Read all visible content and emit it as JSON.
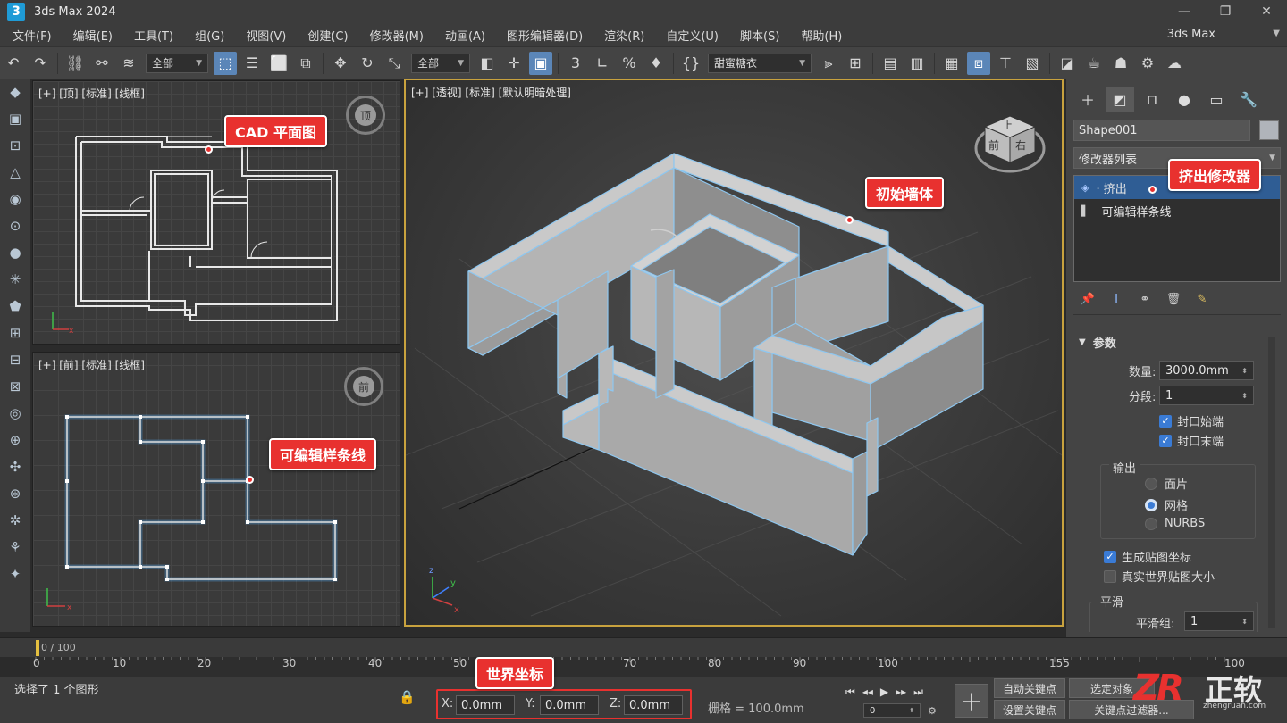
{
  "app": {
    "logo_text": "3",
    "title": "3ds Max 2024",
    "workspace": "3ds Max"
  },
  "window_controls": [
    "—",
    "❐",
    "✕"
  ],
  "menu": [
    "文件(F)",
    "编辑(E)",
    "工具(T)",
    "组(G)",
    "视图(V)",
    "创建(C)",
    "修改器(M)",
    "动画(A)",
    "图形编辑器(D)",
    "渲染(R)",
    "自定义(U)",
    "脚本(S)",
    "帮助(H)"
  ],
  "toolbar": {
    "selection_filter": "全部",
    "ref_coord": "全部",
    "named_selection": "甜蜜糖衣",
    "icons": [
      "undo-icon",
      "redo-icon",
      "link-icon",
      "unlink-icon",
      "bind-icon",
      "select-icon",
      "select-by-name-icon",
      "rect-region-icon",
      "window-crossing-icon",
      "move-icon",
      "rotate-icon",
      "scale-icon",
      "pivot-icon",
      "snap-icon",
      "angle-snap-icon",
      "percent-snap-icon",
      "spinner-snap-icon",
      "edit-named-sel-icon",
      "mirror-icon",
      "align-icon",
      "layer-icon",
      "ribbon-icon",
      "render-setup-icon",
      "render-frame-icon",
      "render-icon"
    ]
  },
  "viewports": {
    "top": {
      "label": "[+] [顶] [标准] [线框]",
      "cube": "顶",
      "callout": "CAD 平面图"
    },
    "front": {
      "label": "[+] [前] [标准] [线框]",
      "cube": "前",
      "callout": "可编辑样条线"
    },
    "persp": {
      "label": "[+] [透视] [标准] [默认明暗处理]",
      "cube_top": "上",
      "cube_front": "前",
      "cube_right": "右",
      "callout": "初始墙体"
    }
  },
  "panel": {
    "object_name": "Shape001",
    "modifier_list": "修改器列表",
    "stack": [
      {
        "label": "· 挤出",
        "selected": true
      },
      {
        "label": "可编辑样条线",
        "selected": false
      }
    ],
    "stack_callout": "挤出修改器",
    "rollout_title": "参数",
    "amount_label": "数量:",
    "amount_value": "3000.0mm",
    "segments_label": "分段:",
    "segments_value": "1",
    "cap_start": "封口始端",
    "cap_end": "封口末端",
    "output_label": "输出",
    "output_options": [
      "面片",
      "网格",
      "NURBS"
    ],
    "output_selected": 1,
    "gen_mapping": "生成贴图坐标",
    "real_world": "真实世界贴图大小",
    "smooth_label": "平滑",
    "smooth_group_label": "平滑组:",
    "smooth_group_value": "1"
  },
  "timeline": {
    "frame_display": "0 / 100",
    "ticks": [
      "0",
      "10",
      "20",
      "30",
      "40",
      "50",
      "60",
      "70",
      "80",
      "90",
      "100",
      "155",
      "100"
    ]
  },
  "status": {
    "selection_text": "选择了 1 个图形",
    "coord_callout": "世界坐标",
    "x_label": "X:",
    "x_value": "0.0mm",
    "y_label": "Y:",
    "y_value": "0.0mm",
    "z_label": "Z:",
    "z_value": "0.0mm",
    "grid_text": "栅格 = 100.0mm",
    "auto_key": "自动关键点",
    "set_key": "设置关键点",
    "selected_label": "选定对象",
    "key_filters": "关键点过滤器...",
    "frame_field": "0"
  },
  "watermark": {
    "logo": "ZR",
    "name": "正软",
    "url": "zhengruan.com"
  },
  "colors": {
    "accent_blue": "#3a7bd5",
    "callout_red": "#e8312f",
    "active_viewport": "#c8a23e",
    "spline_selected": "#4fa3e8"
  }
}
